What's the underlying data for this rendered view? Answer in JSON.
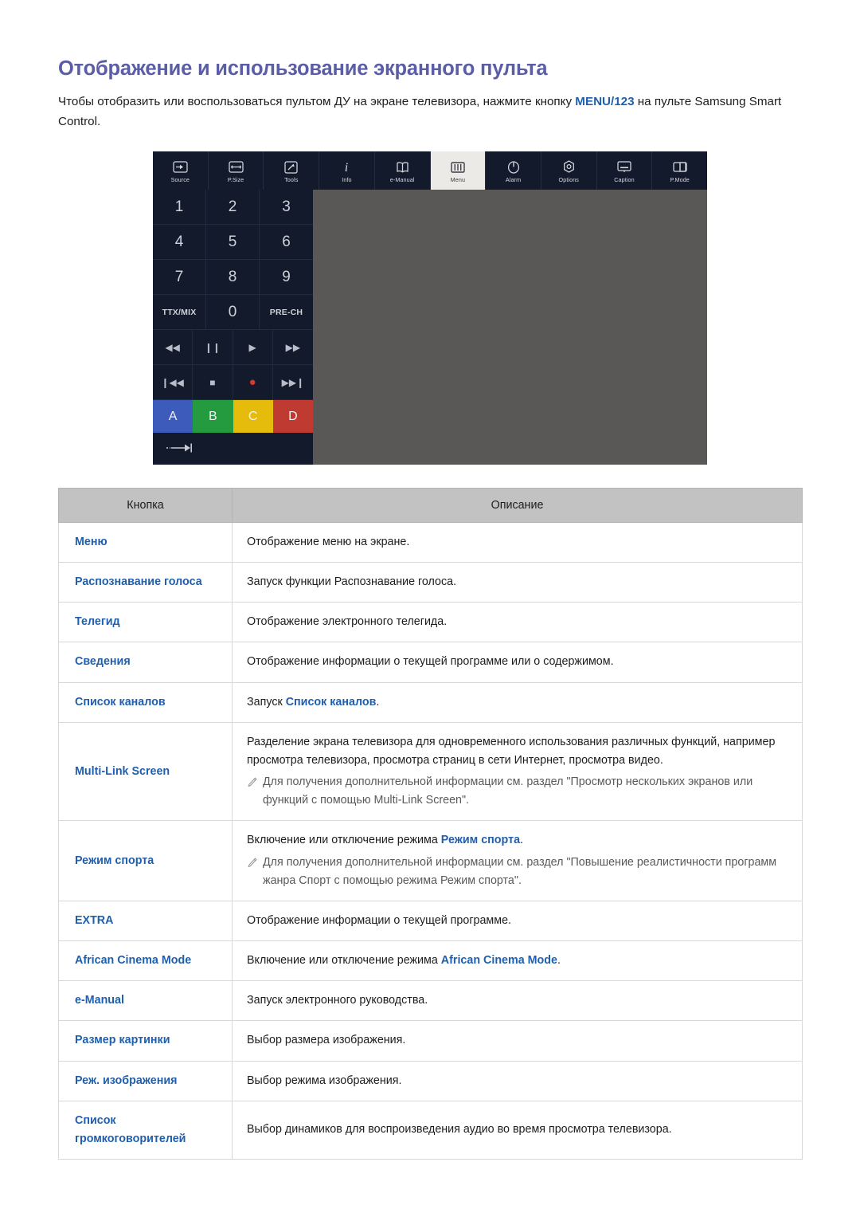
{
  "page": {
    "title": "Отображение и использование экранного пульта",
    "intro_before": "Чтобы отобразить или воспользоваться пультом ДУ на экране телевизора, нажмите кнопку ",
    "intro_accent": "MENU/123",
    "intro_after": " на пульте Samsung Smart Control.",
    "title_color": "#5b5ea6",
    "accent_color": "#1f5fae"
  },
  "remote": {
    "panel_bg": "#5a5856",
    "dark_bg": "#121a2b",
    "active_bg": "#eceae7",
    "top_buttons": [
      {
        "label": "Source",
        "icon": "source-icon",
        "active": false
      },
      {
        "label": "P.Size",
        "icon": "picture-size-icon",
        "active": false
      },
      {
        "label": "Tools",
        "icon": "tools-icon",
        "active": false
      },
      {
        "label": "Info",
        "icon": "info-icon",
        "active": false
      },
      {
        "label": "e-Manual",
        "icon": "e-manual-icon",
        "active": false
      },
      {
        "label": "Menu",
        "icon": "menu-icon",
        "active": true
      },
      {
        "label": "Alarm",
        "icon": "alarm-power-icon",
        "active": false
      },
      {
        "label": "Options",
        "icon": "options-gear-icon",
        "active": false
      },
      {
        "label": "Caption",
        "icon": "caption-icon",
        "active": false
      },
      {
        "label": "P.Mode",
        "icon": "picture-mode-icon",
        "active": false
      }
    ],
    "numpad": [
      "1",
      "2",
      "3",
      "4",
      "5",
      "6",
      "7",
      "8",
      "9",
      "TTX/MIX",
      "0",
      "PRE-CH"
    ],
    "media_row1": [
      {
        "label": "◀◀",
        "name": "rewind-icon"
      },
      {
        "label": "❙❙",
        "name": "pause-icon"
      },
      {
        "label": "▶",
        "name": "play-icon"
      },
      {
        "label": "▶▶",
        "name": "fast-forward-icon"
      }
    ],
    "media_row2": [
      {
        "label": "❙◀◀",
        "name": "previous-icon"
      },
      {
        "label": "■",
        "name": "stop-icon"
      },
      {
        "label": "●",
        "name": "record-icon"
      },
      {
        "label": "▶▶❙",
        "name": "next-icon"
      }
    ],
    "color_buttons": [
      {
        "label": "A",
        "color": "#3c5bba"
      },
      {
        "label": "B",
        "color": "#259b3f"
      },
      {
        "label": "C",
        "color": "#e5bc0b"
      },
      {
        "label": "D",
        "color": "#bf3b32"
      }
    ],
    "exit_icon": "arrow-to-bar-icon"
  },
  "table": {
    "headers": [
      "Кнопка",
      "Описание"
    ],
    "rows": [
      {
        "key": "Меню",
        "desc_prefix": "Отображение меню на экране.",
        "desc_link": "",
        "desc_suffix": "",
        "note": ""
      },
      {
        "key": "Распознавание голоса",
        "desc_prefix": "Запуск функции Распознавание голоса.",
        "desc_link": "",
        "desc_suffix": "",
        "note": ""
      },
      {
        "key": "Телегид",
        "desc_prefix": "Отображение электронного телегида.",
        "desc_link": "",
        "desc_suffix": "",
        "note": ""
      },
      {
        "key": "Сведения",
        "desc_prefix": "Отображение информации о текущей программе или о содержимом.",
        "desc_link": "",
        "desc_suffix": "",
        "note": ""
      },
      {
        "key": "Список каналов",
        "desc_prefix": "Запуск ",
        "desc_link": "Список каналов",
        "desc_suffix": ".",
        "note": ""
      },
      {
        "key": "Multi-Link Screen",
        "desc_prefix": "Разделение экрана телевизора для одновременного использования различных функций, например просмотра телевизора, просмотра страниц в сети Интернет, просмотра видео.",
        "desc_link": "",
        "desc_suffix": "",
        "note": "Для получения дополнительной информации см. раздел \"Просмотр нескольких экранов или функций с помощью Multi-Link Screen\"."
      },
      {
        "key": "Режим спорта",
        "desc_prefix": "Включение или отключение режима ",
        "desc_link": "Режим спорта",
        "desc_suffix": ".",
        "note": "Для получения дополнительной информации см. раздел \"Повышение реалистичности программ жанра Спорт с помощью режима Режим спорта\"."
      },
      {
        "key": "EXTRA",
        "desc_prefix": "Отображение информации о текущей программе.",
        "desc_link": "",
        "desc_suffix": "",
        "note": ""
      },
      {
        "key": "African Cinema Mode",
        "desc_prefix": "Включение или отключение режима ",
        "desc_link": "African Cinema Mode",
        "desc_suffix": ".",
        "note": ""
      },
      {
        "key": "e-Manual",
        "desc_prefix": "Запуск электронного руководства.",
        "desc_link": "",
        "desc_suffix": "",
        "note": ""
      },
      {
        "key": "Размер картинки",
        "desc_prefix": "Выбор размера изображения.",
        "desc_link": "",
        "desc_suffix": "",
        "note": ""
      },
      {
        "key": "Реж. изображения",
        "desc_prefix": "Выбор режима изображения.",
        "desc_link": "",
        "desc_suffix": "",
        "note": ""
      },
      {
        "key": "Список\nгромкоговорителей",
        "desc_prefix": "Выбор динамиков для воспроизведения аудио во время просмотра телевизора.",
        "desc_link": "",
        "desc_suffix": "",
        "note": ""
      }
    ]
  }
}
